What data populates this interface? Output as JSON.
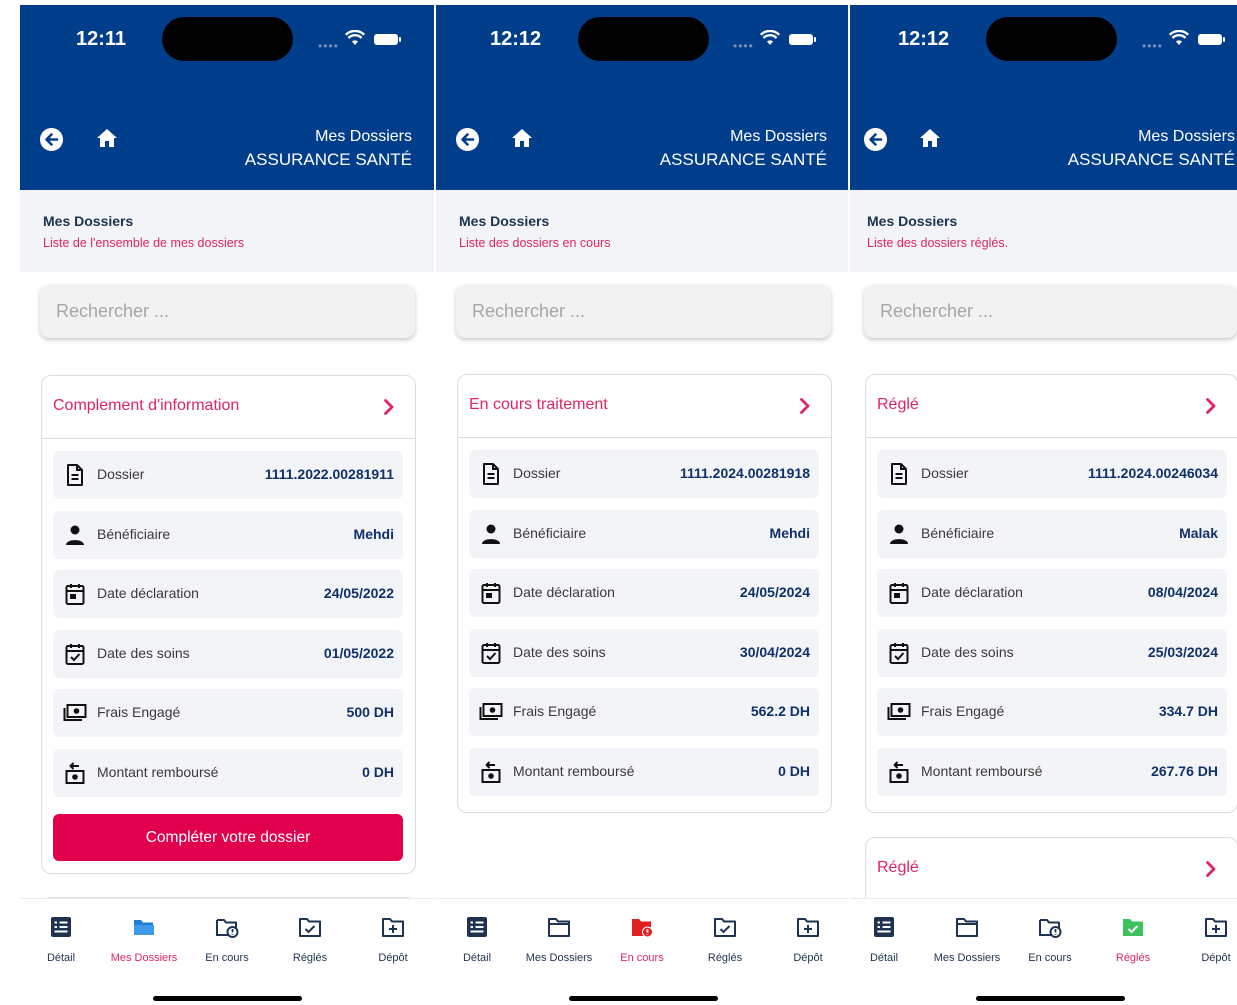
{
  "colors": {
    "header_bg": "#003e8c",
    "accent": "#e0245e",
    "primary_text": "#10306a",
    "button_bg": "#e0004d",
    "active_folder_blue": "#1e7fd6",
    "active_encours_red": "#e02020",
    "active_regles_green": "#3cc15c"
  },
  "screens": [
    {
      "time": "12:11",
      "header": {
        "line1": "Mes Dossiers",
        "line2": "ASSURANCE SANTÉ"
      },
      "subheader": {
        "title": "Mes Dossiers",
        "description": "Liste de l'ensemble de mes dossiers"
      },
      "search": {
        "placeholder": "Rechercher ..."
      },
      "cards": [
        {
          "status": "Complement d'information",
          "fields": [
            {
              "icon": "document-icon",
              "label": "Dossier",
              "value": "1111.2022.00281911"
            },
            {
              "icon": "person-icon",
              "label": "Bénéficiaire",
              "value": "Mehdi"
            },
            {
              "icon": "calendar-icon",
              "label": "Date déclaration",
              "value": "24/05/2022"
            },
            {
              "icon": "calendar-check-icon",
              "label": "Date des soins",
              "value": "01/05/2022"
            },
            {
              "icon": "money-icon",
              "label": "Frais Engagé",
              "value": "500 DH"
            },
            {
              "icon": "refund-icon",
              "label": "Montant remboursé",
              "value": "0 DH"
            }
          ],
          "button": "Compléter votre dossier"
        }
      ],
      "active_tab": 1
    },
    {
      "time": "12:12",
      "header": {
        "line1": "Mes Dossiers",
        "line2": "ASSURANCE SANTÉ"
      },
      "subheader": {
        "title": "Mes Dossiers",
        "description": "Liste des dossiers en cours"
      },
      "search": {
        "placeholder": "Rechercher ..."
      },
      "cards": [
        {
          "status": "En cours traitement",
          "fields": [
            {
              "icon": "document-icon",
              "label": "Dossier",
              "value": "1111.2024.00281918"
            },
            {
              "icon": "person-icon",
              "label": "Bénéficiaire",
              "value": "Mehdi"
            },
            {
              "icon": "calendar-icon",
              "label": "Date déclaration",
              "value": "24/05/2024"
            },
            {
              "icon": "calendar-check-icon",
              "label": "Date des soins",
              "value": "30/04/2024"
            },
            {
              "icon": "money-icon",
              "label": "Frais Engagé",
              "value": "562.2 DH"
            },
            {
              "icon": "refund-icon",
              "label": "Montant remboursé",
              "value": "0 DH"
            }
          ]
        }
      ],
      "active_tab": 2
    },
    {
      "time": "12:12",
      "header": {
        "line1": "Mes Dossiers",
        "line2": "ASSURANCE SANTÉ"
      },
      "subheader": {
        "title": "Mes Dossiers",
        "description": "Liste des dossiers réglés."
      },
      "search": {
        "placeholder": "Rechercher ..."
      },
      "cards": [
        {
          "status": "Réglé",
          "fields": [
            {
              "icon": "document-icon",
              "label": "Dossier",
              "value": "1111.2024.00246034"
            },
            {
              "icon": "person-icon",
              "label": "Bénéficiaire",
              "value": "Malak"
            },
            {
              "icon": "calendar-icon",
              "label": "Date déclaration",
              "value": "08/04/2024"
            },
            {
              "icon": "calendar-check-icon",
              "label": "Date des soins",
              "value": "25/03/2024"
            },
            {
              "icon": "money-icon",
              "label": "Frais Engagé",
              "value": "334.7 DH"
            },
            {
              "icon": "refund-icon",
              "label": "Montant remboursé",
              "value": "267.76 DH"
            }
          ]
        },
        {
          "status": "Réglé",
          "fields": []
        }
      ],
      "active_tab": 3
    }
  ],
  "tabs": [
    {
      "label": "Détail",
      "icon": "list-icon"
    },
    {
      "label": "Mes Dossiers",
      "icon": "folder-icon"
    },
    {
      "label": "En cours",
      "icon": "folder-alert-icon"
    },
    {
      "label": "Réglés",
      "icon": "folder-check-icon"
    },
    {
      "label": "Dépôt",
      "icon": "folder-plus-icon"
    }
  ]
}
